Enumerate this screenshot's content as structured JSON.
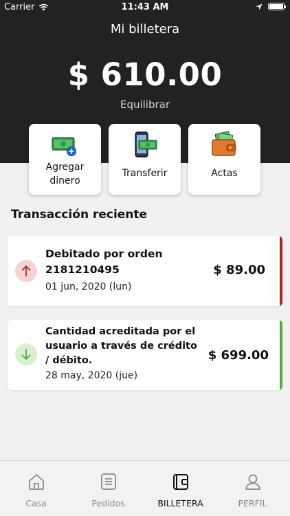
{
  "status_bar": {
    "carrier": "Carrier",
    "time": "11:43 AM"
  },
  "header": {
    "title": "Mi billetera",
    "balance": "$ 610.00",
    "balance_label": "Equilibrar"
  },
  "actions": [
    {
      "label": "Agregar dinero",
      "icon": "add-money-icon"
    },
    {
      "label": "Transferir",
      "icon": "transfer-phone-icon"
    },
    {
      "label": "Actas",
      "icon": "wallet-icon"
    }
  ],
  "section_title": "Transacción reciente",
  "transactions": [
    {
      "title": "Debitado por orden 2181210495",
      "date": "01 jun, 2020 (lun)",
      "amount": "$ 89.00",
      "direction": "debit",
      "accent": "#b3261e",
      "icon_bg": "#f6d3d3"
    },
    {
      "title": "Cantidad acreditada por el usuario a través de crédito / débito.",
      "date": "28 may, 2020 (jue)",
      "amount": "$ 699.00",
      "direction": "credit",
      "accent": "#5aa83c",
      "icon_bg": "#d9efcf"
    }
  ],
  "tabs": [
    {
      "label": "Casa",
      "icon": "home-icon",
      "active": false
    },
    {
      "label": "Pedidos",
      "icon": "orders-icon",
      "active": false
    },
    {
      "label": "BILLETERA",
      "icon": "wallet-tab-icon",
      "active": true
    },
    {
      "label": "PERFIL",
      "icon": "profile-icon",
      "active": false
    }
  ],
  "colors": {
    "header_bg": "#222222",
    "page_bg": "#f1f1f3",
    "debit": "#b3261e",
    "credit": "#5aa83c"
  }
}
